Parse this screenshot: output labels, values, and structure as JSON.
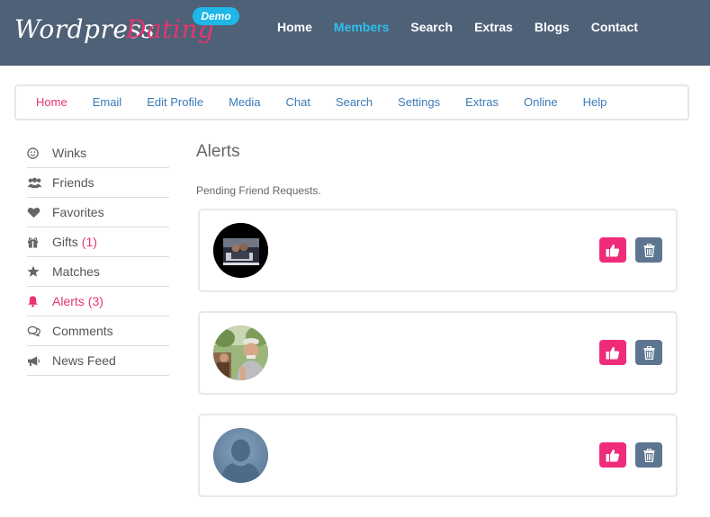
{
  "brand": {
    "word1": "Wordpress",
    "word2": "Dating",
    "badge": "Demo"
  },
  "topnav": [
    {
      "label": "Home",
      "active": false
    },
    {
      "label": "Members",
      "active": true
    },
    {
      "label": "Search",
      "active": false
    },
    {
      "label": "Extras",
      "active": false
    },
    {
      "label": "Blogs",
      "active": false
    },
    {
      "label": "Contact",
      "active": false
    }
  ],
  "subnav": [
    {
      "label": "Home",
      "active": true
    },
    {
      "label": "Email"
    },
    {
      "label": "Edit Profile"
    },
    {
      "label": "Media"
    },
    {
      "label": "Chat"
    },
    {
      "label": "Search"
    },
    {
      "label": "Settings"
    },
    {
      "label": "Extras"
    },
    {
      "label": "Online"
    },
    {
      "label": "Help"
    }
  ],
  "sidebar": [
    {
      "label": "Winks",
      "count": "",
      "icon": "smile-icon"
    },
    {
      "label": "Friends",
      "count": "",
      "icon": "users-icon"
    },
    {
      "label": "Favorites",
      "count": "",
      "icon": "heart-icon"
    },
    {
      "label": "Gifts",
      "count": "(1)",
      "icon": "gift-icon"
    },
    {
      "label": "Matches",
      "count": "",
      "icon": "star-icon"
    },
    {
      "label": "Alerts",
      "count": "(3)",
      "icon": "bell-icon",
      "active": true
    },
    {
      "label": "Comments",
      "count": "",
      "icon": "comments-icon"
    },
    {
      "label": "News Feed",
      "count": "",
      "icon": "megaphone-icon"
    }
  ],
  "main": {
    "title": "Alerts",
    "subtitle": "Pending Friend Requests.",
    "requests": [
      {
        "avatar": "photo-avatar-1"
      },
      {
        "avatar": "photo-avatar-2"
      },
      {
        "avatar": "placeholder-avatar"
      }
    ]
  },
  "colors": {
    "header_bg": "#4f6177",
    "accent_pink": "#e8336f",
    "accent_blue": "#2ec0f0",
    "like_button": "#ef2b7a",
    "delete_button": "#5d7590"
  }
}
